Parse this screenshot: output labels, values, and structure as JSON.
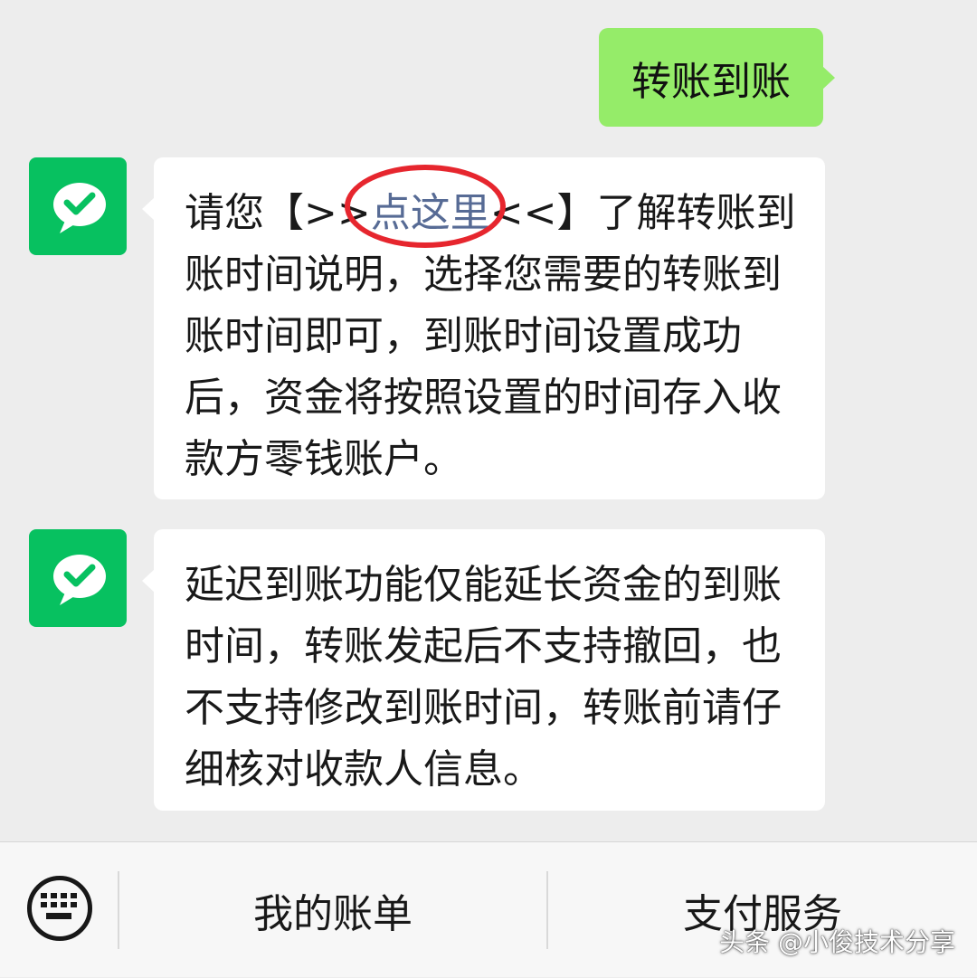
{
  "chat": {
    "sent_message": "转账到账",
    "messages": [
      {
        "lines": [
          {
            "before": "请您【>>",
            "link": "点这里",
            "after": "<<】了解转账到"
          },
          "账时间说明，选择您需要的转账到",
          "账时间即可，到账时间设置成功",
          "后，资金将按照设置的时间存入收",
          "款方零钱账户。"
        ]
      },
      {
        "lines": [
          "延迟到账功能仅能延长资金的到账",
          "时间，转账发起后不支持撤回，也",
          "不支持修改到账时间，转账前请仔",
          "细核对收款人信息。"
        ]
      }
    ]
  },
  "bottom_menu": {
    "keyboard_icon": "keyboard-icon",
    "items": [
      "我的账单",
      "支付服务"
    ]
  },
  "watermark": "头条 @小俊技术分享",
  "colors": {
    "background": "#ededed",
    "sent_bubble": "#95ec69",
    "avatar_green": "#07c160",
    "link": "#576b95",
    "highlight_circle": "#e6262e"
  }
}
